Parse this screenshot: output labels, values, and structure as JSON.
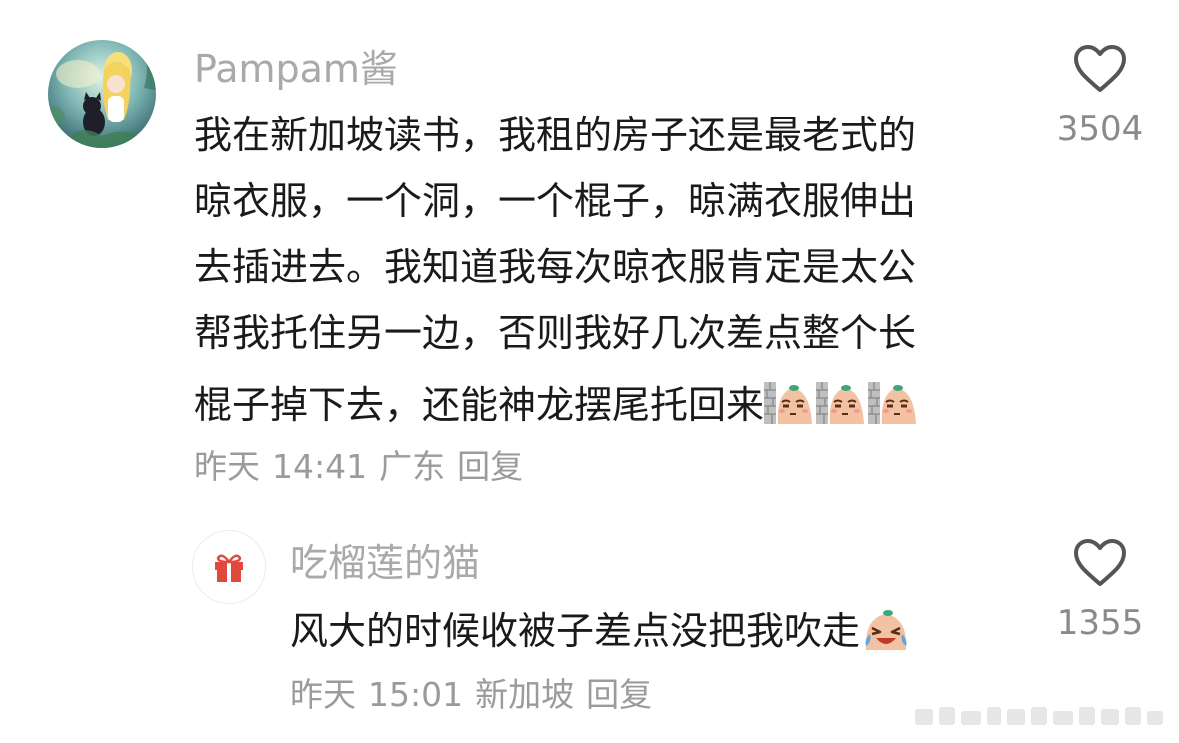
{
  "comments": [
    {
      "username": "Pampam酱",
      "lines": [
        "我在新加坡读书，我租的房子还是最老式的",
        "晾衣服，一个洞，一个棍子，晾满衣服伸出",
        "去插进去。我知道我每次晾衣服肯定是太公",
        "帮我托住另一边，否则我好几次差点整个长",
        "棍子掉下去，还能神龙摆尾托回来"
      ],
      "emoji": "peeking-behind-wall-emoji",
      "emoji_count": 3,
      "date": "昨天",
      "time": "14:41",
      "location": "广东",
      "reply_label": "回复",
      "likes": "3504"
    },
    {
      "username": "吃榴莲的猫",
      "lines": [
        "风大的时候收被子差点没把我吹走"
      ],
      "emoji": "crying-laughing-emoji",
      "date": "昨天",
      "time": "15:01",
      "location": "新加坡",
      "reply_label": "回复",
      "likes": "1355"
    }
  ],
  "icons": {
    "like": "heart-outline-icon",
    "gift_badge": "gift-icon"
  },
  "colors": {
    "text": "#1a1a1a",
    "username": "#a9a9a9",
    "meta": "#9b9b9b",
    "like_count": "#8a8a8a",
    "emoji_face": "#f2c2a3",
    "emoji_leaf": "#3ca77a",
    "gift_red": "#e0493c"
  }
}
